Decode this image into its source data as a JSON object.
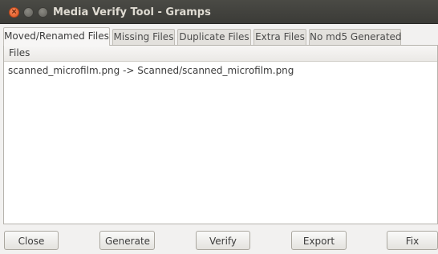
{
  "window": {
    "title": "Media Verify Tool - Gramps",
    "controls": [
      "close-icon",
      "minimize-icon",
      "maximize-icon"
    ]
  },
  "tabs": [
    {
      "label": "Moved/Renamed Files",
      "active": true
    },
    {
      "label": "Missing Files",
      "active": false
    },
    {
      "label": "Duplicate Files",
      "active": false
    },
    {
      "label": "Extra Files",
      "active": false
    },
    {
      "label": "No md5 Generated",
      "active": false
    }
  ],
  "list": {
    "column_header": "Files",
    "rows": [
      "scanned_microfilm.png -> Scanned/scanned_microfilm.png"
    ]
  },
  "buttons": {
    "close": "Close",
    "generate": "Generate",
    "verify": "Verify",
    "export": "Export",
    "fix": "Fix"
  }
}
